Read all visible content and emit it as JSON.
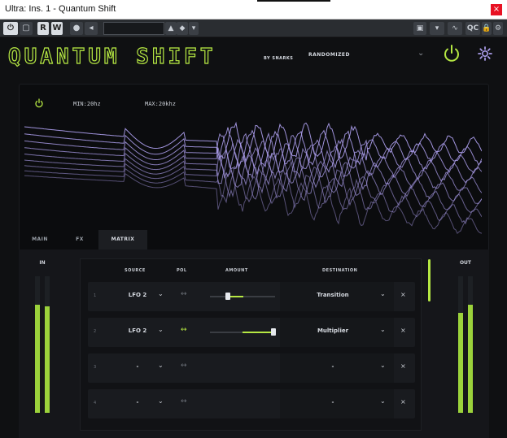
{
  "window": {
    "title": "Ultra: Ins. 1 - Quantum Shift",
    "close_glyph": "×"
  },
  "host_toolbar": {
    "buttons": [
      "R",
      "W"
    ],
    "qc_label": "QC"
  },
  "plugin": {
    "logo": "QUANTUM SHIFT",
    "byline": "BY SNARKS",
    "preset_name": "RANDOMIZED",
    "accent": "#b6e843"
  },
  "spectrum": {
    "min_label": "MIN:20hz",
    "max_label": "MAX:20khz",
    "line_color": "#a99be8"
  },
  "tabs": [
    {
      "label": "MAIN",
      "active": false
    },
    {
      "label": "FX",
      "active": false
    },
    {
      "label": "MATRIX",
      "active": true
    }
  ],
  "meters": {
    "in_label": "IN",
    "out_label": "OUT",
    "in_levels": [
      0.79,
      0.78
    ],
    "out_levels": [
      0.73,
      0.79
    ]
  },
  "matrix": {
    "headers": {
      "source": "SOURCE",
      "pol": "POL",
      "amount": "AMOUNT",
      "destination": "DESTINATION"
    },
    "rows": [
      {
        "index": "1",
        "source": "LFO 2",
        "polarity_active": false,
        "amount": 0.27,
        "destination": "Transition"
      },
      {
        "index": "2",
        "source": "LFO 2",
        "polarity_active": true,
        "amount": 0.97,
        "destination": "Multiplier"
      },
      {
        "index": "3",
        "source": "-",
        "polarity_active": false,
        "amount": null,
        "destination": "-"
      },
      {
        "index": "4",
        "source": "-",
        "polarity_active": false,
        "amount": null,
        "destination": "-"
      }
    ]
  }
}
